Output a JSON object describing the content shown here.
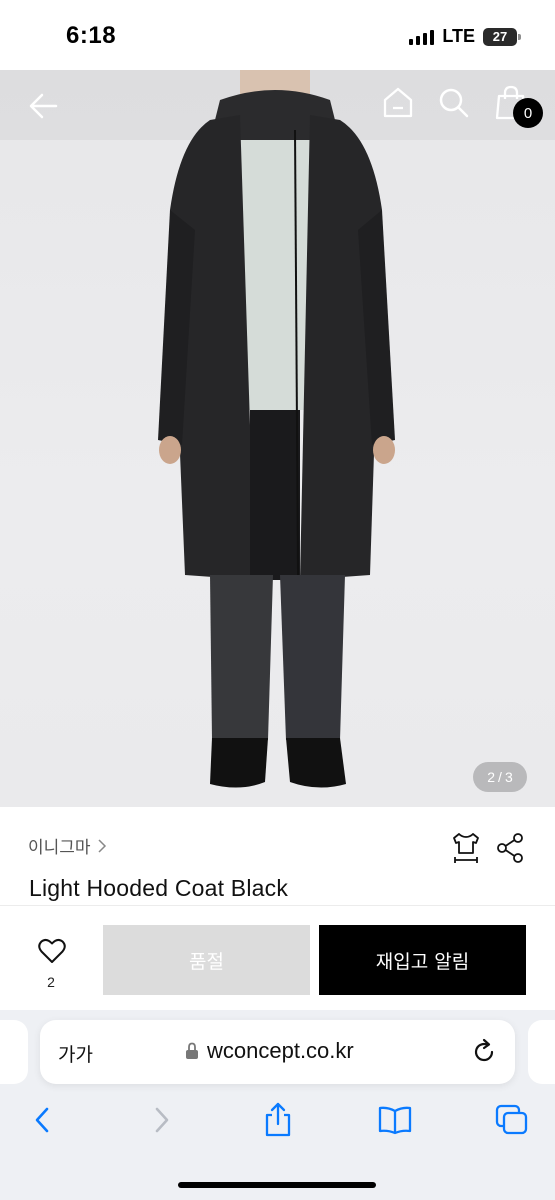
{
  "status_bar": {
    "time": "6:18",
    "network": "LTE",
    "battery": "27"
  },
  "product_image": {
    "pager_current": "2",
    "pager_separator": "/",
    "pager_total": "3",
    "cart_count": "0"
  },
  "product": {
    "brand": "이니그마",
    "name": "Light Hooded Coat Black"
  },
  "actions": {
    "wishlist_count": "2",
    "sold_out_label": "품절",
    "restock_alert_label": "재입고 알림"
  },
  "browser": {
    "text_size_label": "가가",
    "url": "wconcept.co.kr"
  },
  "colors": {
    "accent": "#0a7aff",
    "primary_button": "#000000",
    "disabled_button": "#dcdcdc"
  },
  "icons": [
    "back-arrow-icon",
    "home-icon",
    "search-icon",
    "shopping-bag-icon",
    "size-guide-icon",
    "share-icon",
    "heart-icon",
    "lock-icon",
    "reload-icon",
    "chevron-left-icon",
    "chevron-right-icon",
    "share-upload-icon",
    "bookmarks-icon",
    "tabs-icon"
  ]
}
